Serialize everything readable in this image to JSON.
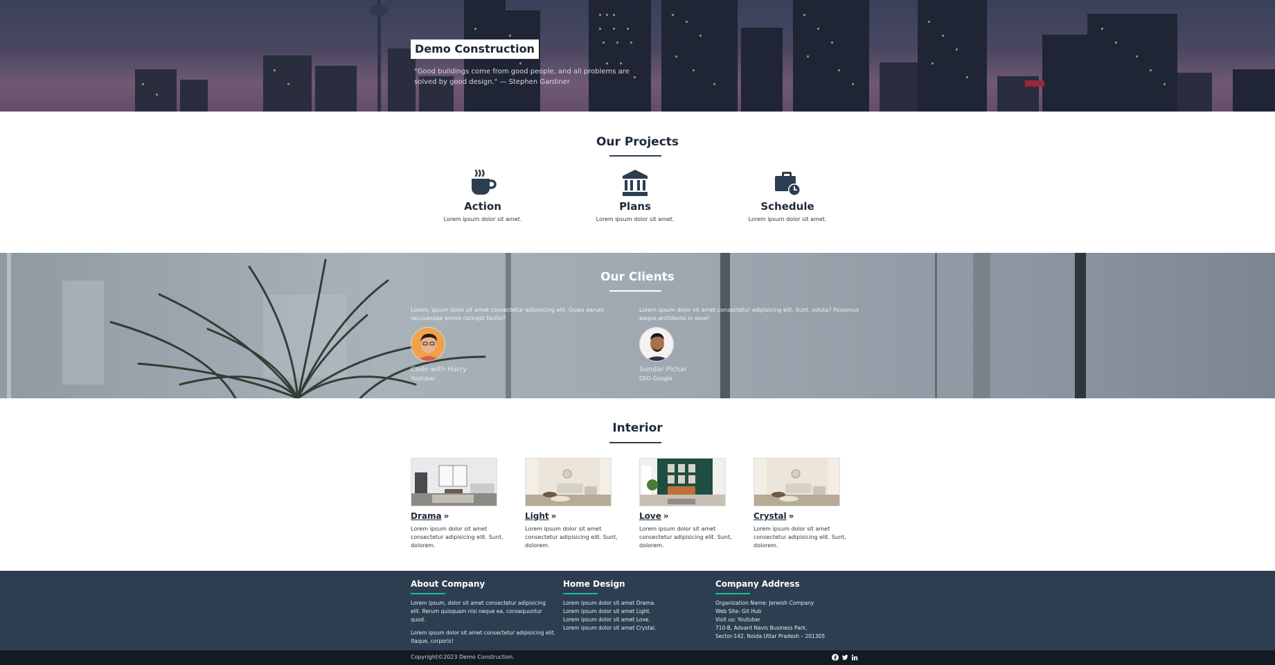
{
  "hero": {
    "title": "Demo Construction",
    "quote": "\"Good buildings come from good people, and all problems are solved by good design.\" — Stephen Gardiner"
  },
  "projects": {
    "title": "Our Projects",
    "items": [
      {
        "icon": "coffee-icon",
        "name": "Action",
        "desc": "Lorem ipsum dolor sit amet."
      },
      {
        "icon": "landmark-icon",
        "name": "Plans",
        "desc": "Lorem ipsum dolor sit amet."
      },
      {
        "icon": "business-time-icon",
        "name": "Schedule",
        "desc": "Lorem ipsum dolor sit amet."
      }
    ]
  },
  "clients": {
    "title": "Our Clients",
    "items": [
      {
        "quote": "Lorem, ipsum dolor sit amet consectetur adipisicing elit. Quasi earum recusandae omnis corrupti facilis?",
        "name": "Code with Harry",
        "role": "Youtuber"
      },
      {
        "quote": "Lorem ipsum dolor sit amet consectetur adipisicing elit. Sunt, soluta? Possimus eaque architecto in esse!",
        "name": "Sundar Pichai",
        "role": "CEO Google"
      }
    ]
  },
  "interior": {
    "title": "Interior",
    "items": [
      {
        "title": "Drama",
        "desc": "Lorem ipsum dolor sit amet consectetur adipisicing elit. Sunt, dolorem."
      },
      {
        "title": "Light",
        "desc": "Lorem ipsum dolor sit amet consectetur adipisicing elit. Sunt, dolorem."
      },
      {
        "title": "Love",
        "desc": "Lorem ipsum dolor sit amet consectetur adipisicing elit. Sunt, dolorem."
      },
      {
        "title": "Crystal",
        "desc": "Lorem ipsum dolor sit amet consectetur adipisicing elit. Sunt, dolorem."
      }
    ]
  },
  "footer": {
    "about": {
      "heading": "About Company",
      "p1": "Lorem ipsum, dolor sit amet consectetur adipisicing elit. Rerum quisquam nisi neque ea, consequuntur quod.",
      "p2": "Lorem ipsum dolor sit amet consectetur adipisicing elit. Itaque, corporis!"
    },
    "home_design": {
      "heading": "Home Design",
      "lines": [
        "Lorem ipsum dolor sit amet Drama.",
        "Lorem ipsum dolor sit amet Light.",
        "Lorem ipsum dolor sit amet Love.",
        "Lorem ipsum dolor sit amet Crystal."
      ]
    },
    "address": {
      "heading": "Company Address",
      "lines": [
        "Organization Name: Jerwish Company",
        "Web Site: Git Hub",
        "Visit us: Youtuber",
        "710-B, Advant Navis Business Park,",
        "Sector-142, Noida Uttar Pradesh – 201305"
      ]
    },
    "copyright": "Copyright©2023 Demo Construction.",
    "social": [
      "facebook-icon",
      "twitter-icon",
      "linkedin-icon"
    ]
  },
  "colors": {
    "footer_bg": "#2c3e50",
    "bottom_bar": "#121a22",
    "accent": "#1abc9c",
    "heading": "#1e2a38"
  }
}
